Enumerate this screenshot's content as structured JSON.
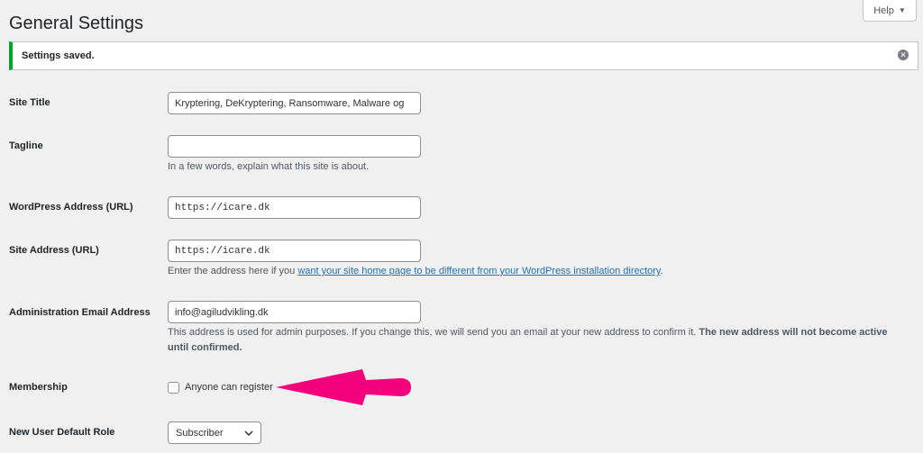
{
  "header": {
    "title": "General Settings",
    "help_label": "Help"
  },
  "notice": {
    "message": "Settings saved.",
    "dismiss_icon": "close-circle-icon"
  },
  "fields": {
    "site_title": {
      "label": "Site Title",
      "value": "Kryptering, DeKryptering, Ransomware, Malware og"
    },
    "tagline": {
      "label": "Tagline",
      "value": "",
      "description": "In a few words, explain what this site is about."
    },
    "wp_address": {
      "label": "WordPress Address (URL)",
      "value": "https://icare.dk"
    },
    "site_address": {
      "label": "Site Address (URL)",
      "value": "https://icare.dk",
      "description_prefix": "Enter the address here if you ",
      "description_link": "want your site home page to be different from your WordPress installation directory",
      "description_suffix": "."
    },
    "admin_email": {
      "label": "Administration Email Address",
      "value": "info@agiludvikling.dk",
      "description": "This address is used for admin purposes. If you change this, we will send you an email at your new address to confirm it. ",
      "description_bold": "The new address will not become active until confirmed."
    },
    "membership": {
      "label": "Membership",
      "checkbox_label": "Anyone can register",
      "checked": false
    },
    "default_role": {
      "label": "New User Default Role",
      "selected": "Subscriber"
    }
  },
  "colors": {
    "notice_border": "#00a32a",
    "link": "#2271b1",
    "annotation_arrow": "#f5007c"
  }
}
